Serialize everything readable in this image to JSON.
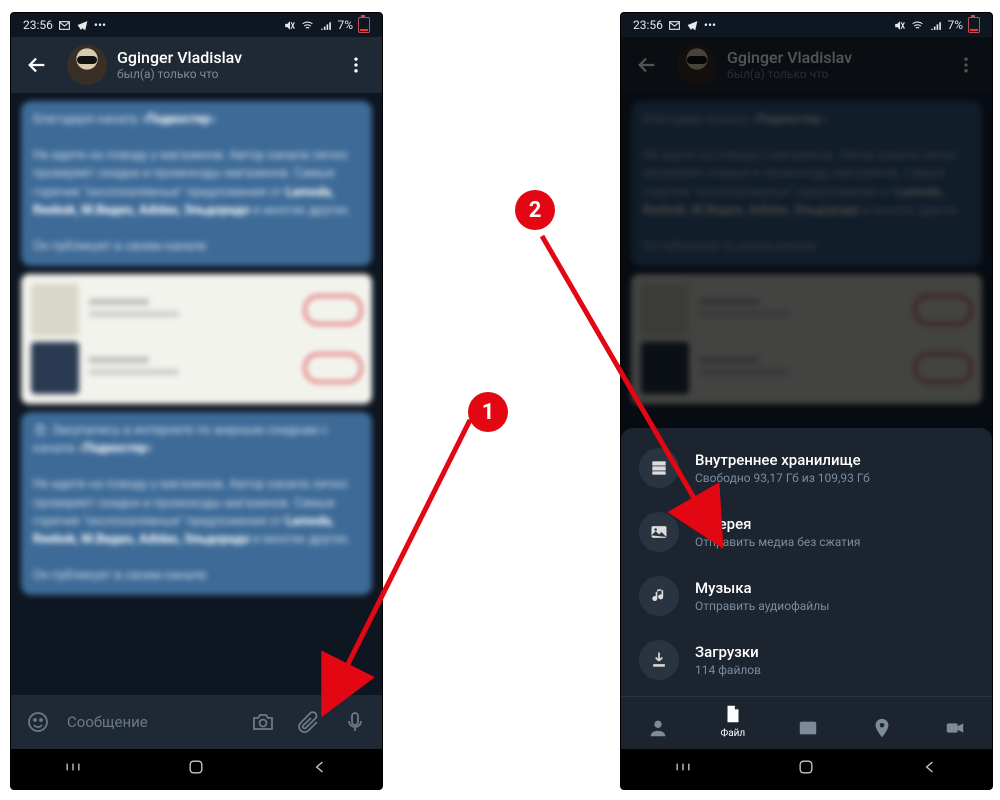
{
  "status": {
    "time": "23:56",
    "battery": "7%"
  },
  "header": {
    "name": "Gginger Vladislav",
    "status": "был(а) только что"
  },
  "input": {
    "placeholder": "Сообщение"
  },
  "sheet": {
    "items": [
      {
        "title": "Внутреннее хранилище",
        "sub": "Свободно 93,17 Гб из 109,93 Гб"
      },
      {
        "title": "Галерея",
        "sub": "Отправить медиа без сжатия"
      },
      {
        "title": "Музыка",
        "sub": "Отправить аудиофайлы"
      },
      {
        "title": "Загрузки",
        "sub": "114 файлов"
      }
    ],
    "tabs": {
      "file": "Файл"
    }
  },
  "callouts": {
    "one": "1",
    "two": "2"
  }
}
